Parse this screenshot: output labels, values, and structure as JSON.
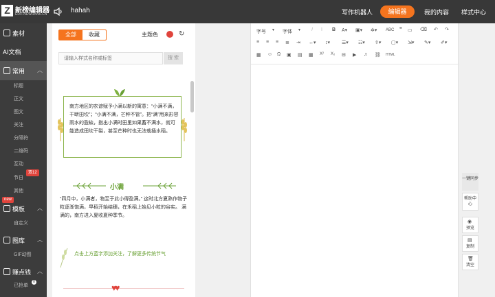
{
  "topbar": {
    "logo_name": "新榜编辑器",
    "logo_sub": "EDIT.NEWRANK.CN",
    "doc_title": "hahah",
    "nav": [
      "写作机器人",
      "编辑器",
      "我的内容",
      "样式中心"
    ]
  },
  "sidebar": {
    "sections": [
      {
        "label": "素材",
        "icon": "material-icon"
      },
      {
        "label": "AI文档",
        "icon": "ai-icon"
      },
      {
        "label": "常用",
        "icon": "common-icon"
      },
      {
        "label": "模板",
        "icon": "template-icon"
      },
      {
        "label": "图库",
        "icon": "gallery-icon"
      },
      {
        "label": "赚点钱",
        "icon": "money-icon"
      }
    ],
    "common_items": [
      "标题",
      "正文",
      "图文",
      "关注",
      "分隔符",
      "二维码",
      "互动",
      "节日",
      "其他"
    ],
    "template_items": [
      "自定义"
    ],
    "gallery_items": [
      "GIF动图"
    ],
    "money_items": [
      "已抢单"
    ],
    "badge_new": "new",
    "badge_festival": "双12",
    "badge_count": "8"
  },
  "panel": {
    "tab_all": "全部",
    "tab_fav": "收藏",
    "theme_label": "主题色",
    "theme_color": "#e0443c",
    "search_placeholder": "请输入样式名称或标签",
    "search_button": "搜 索",
    "card1_text": "南方地区的农谚赋予小满以新的寓意：“小满不满，干断田坎”；“小满不满，芒种不管”。把“满”用来形容雨水的盈缺，指出小满时田里如果蓄不满水，就可能造成田坎干裂，甚至芒种时也无法栽插水稻。",
    "title2": "小满",
    "para2": "“四月中，小满者，物至于此小得盈满。” 这时北方夏熟作物子粒逐渐饱满，早稻开始结穗，在禾稻上始见小粒的谷实。 满满的，南方进入夏收夏种季节。",
    "follow_text": "点击上方蓝字添加关注，了解更多传统节气"
  },
  "editor": {
    "font_size_label": "字号",
    "font_family_label": "字体"
  },
  "rightbar": {
    "sync": "一键同步",
    "help": "帮助中心",
    "preview": "预览",
    "copy": "复制",
    "clear": "清空"
  },
  "colors": {
    "accent": "#f5741e",
    "green": "#6aa135",
    "topbar": "#383838",
    "sidebar": "#3c3c3c"
  }
}
